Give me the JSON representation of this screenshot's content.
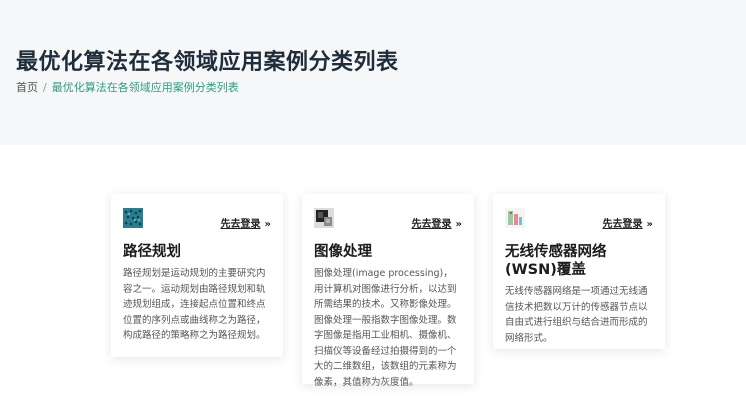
{
  "header": {
    "title": "最优化算法在各领域应用案例分类列表",
    "breadcrumb": {
      "home": "首页",
      "separator": "/",
      "current": "最优化算法在各领域应用案例分类列表"
    }
  },
  "cards": [
    {
      "title": "路径规划",
      "login": "先去登录",
      "description": "路径规划是运动规划的主要研究内容之一。运动规划由路径规划和轨迹规划组成，连接起点位置和终点位置的序列点或曲线称之为路径，构成路径的策略称之为路径规划。",
      "thumb_icon": "path-planning-thumbnail-icon"
    },
    {
      "title": "图像处理",
      "login": "先去登录",
      "description": "图像处理(image processing)，用计算机对图像进行分析，以达到所需结果的技术。又称影像处理。图像处理一般指数字图像处理。数字图像是指用工业相机、摄像机、扫描仪等设备经过拍摄得到的一个大的二维数组，该数组的元素称为像素，其值称为灰度值。",
      "thumb_icon": "image-processing-thumbnail-icon"
    },
    {
      "title": "无线传感器网络(WSN)覆盖",
      "login": "先去登录",
      "description": "无线传感器网络是一项通过无线通信技术把数以万计的传感器节点以自由式进行组织与结合进而形成的网络形式。",
      "thumb_icon": "wsn-thumbnail-icon"
    }
  ],
  "colors": {
    "accent": "#2e9d7a",
    "hero_bg": "#f6f7f8"
  }
}
